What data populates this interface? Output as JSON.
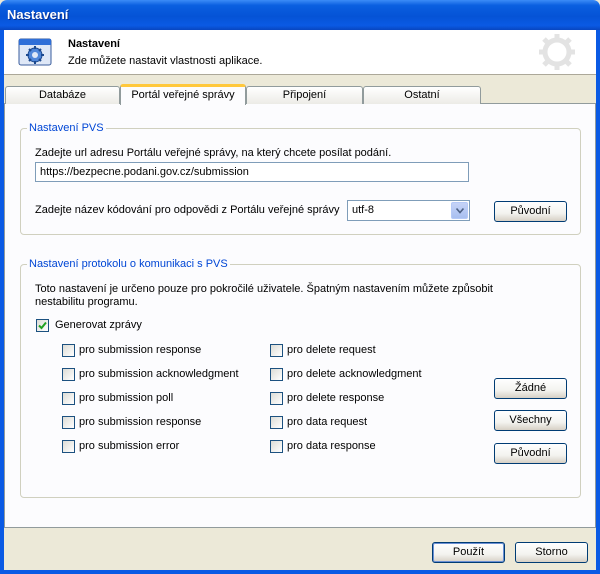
{
  "window": {
    "title": "Nastavení"
  },
  "header": {
    "title": "Nastavení",
    "description": "Zde můžete nastavit vlastnosti aplikace."
  },
  "tabs": [
    {
      "label": "Databáze",
      "active": false
    },
    {
      "label": "Portál veřejné správy",
      "active": true
    },
    {
      "label": "Připojení",
      "active": false
    },
    {
      "label": "Ostatní",
      "active": false
    }
  ],
  "pvs": {
    "legend": "Nastavení PVS",
    "url_label": "Zadejte url adresu Portálu veřejné správy, na který chcete posílat podání.",
    "url_value": "https://bezpecne.podani.gov.cz/submission",
    "encoding_label": "Zadejte název kódování pro odpovědi z Portálu veřejné správy",
    "encoding_value": "utf-8",
    "default_button": "Původní"
  },
  "protocol": {
    "legend": "Nastavení protokolu o komunikaci s PVS",
    "warning_line1": "Toto nastavení je určeno pouze pro pokročilé uživatele. Špatným nastavením můžete způsobit",
    "warning_line2": "nestabilitu programu.",
    "generate": {
      "label": "Generovat zprávy",
      "checked": true
    },
    "left_options": [
      {
        "label": "pro submission response",
        "checked": false
      },
      {
        "label": "pro submission acknowledgment",
        "checked": false
      },
      {
        "label": "pro submission poll",
        "checked": false
      },
      {
        "label": "pro submission response",
        "checked": false
      },
      {
        "label": "pro submission error",
        "checked": false
      }
    ],
    "right_options": [
      {
        "label": "pro delete request",
        "checked": false
      },
      {
        "label": "pro delete acknowledgment",
        "checked": false
      },
      {
        "label": "pro delete response",
        "checked": false
      },
      {
        "label": "pro data request",
        "checked": false
      },
      {
        "label": "pro data response",
        "checked": false
      }
    ],
    "buttons": {
      "none": "Žádné",
      "all": "Všechny",
      "default": "Původní"
    }
  },
  "footer": {
    "apply": "Použít",
    "cancel": "Storno"
  },
  "colors": {
    "title_bar": "#0553d6",
    "legend": "#0046d5",
    "active_tab_accent": "#ffc83c",
    "background": "#ece9d8"
  },
  "icons": {
    "app": "gear-window-icon",
    "watermark": "gear-watermark-icon",
    "dropdown": "chevron-down-icon",
    "check": "checkmark-icon"
  }
}
